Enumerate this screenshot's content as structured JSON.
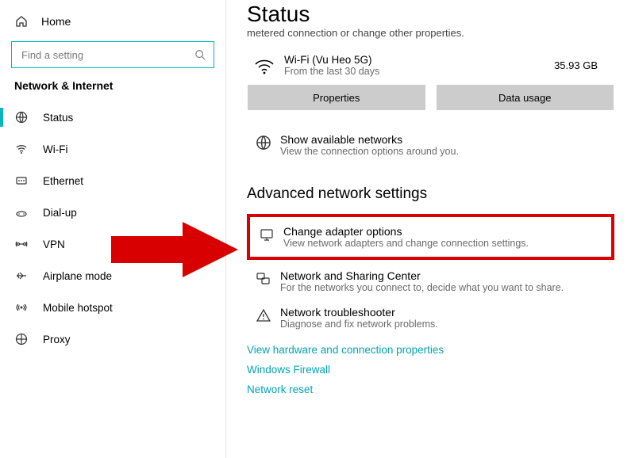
{
  "sidebar": {
    "home": "Home",
    "search_placeholder": "Find a setting",
    "section": "Network & Internet",
    "items": [
      {
        "label": "Status"
      },
      {
        "label": "Wi-Fi"
      },
      {
        "label": "Ethernet"
      },
      {
        "label": "Dial-up"
      },
      {
        "label": "VPN"
      },
      {
        "label": "Airplane mode"
      },
      {
        "label": "Mobile hotspot"
      },
      {
        "label": "Proxy"
      }
    ]
  },
  "main": {
    "title": "Status",
    "subnote": "metered connection or change other properties.",
    "card": {
      "name": "Wi-Fi (Vu Heo 5G)",
      "sub": "From the last 30 days",
      "usage": "35.93 GB",
      "btn_properties": "Properties",
      "btn_datausage": "Data usage"
    },
    "rows": {
      "show": {
        "title": "Show available networks",
        "sub": "View the connection options around you."
      },
      "adv_title": "Advanced network settings",
      "adapter": {
        "title": "Change adapter options",
        "sub": "View network adapters and change connection settings."
      },
      "sharing": {
        "title": "Network and Sharing Center",
        "sub": "For the networks you connect to, decide what you want to share."
      },
      "trouble": {
        "title": "Network troubleshooter",
        "sub": "Diagnose and fix network problems."
      }
    },
    "links": {
      "hw": "View hardware and connection properties",
      "fw": "Windows Firewall",
      "reset": "Network reset"
    }
  }
}
